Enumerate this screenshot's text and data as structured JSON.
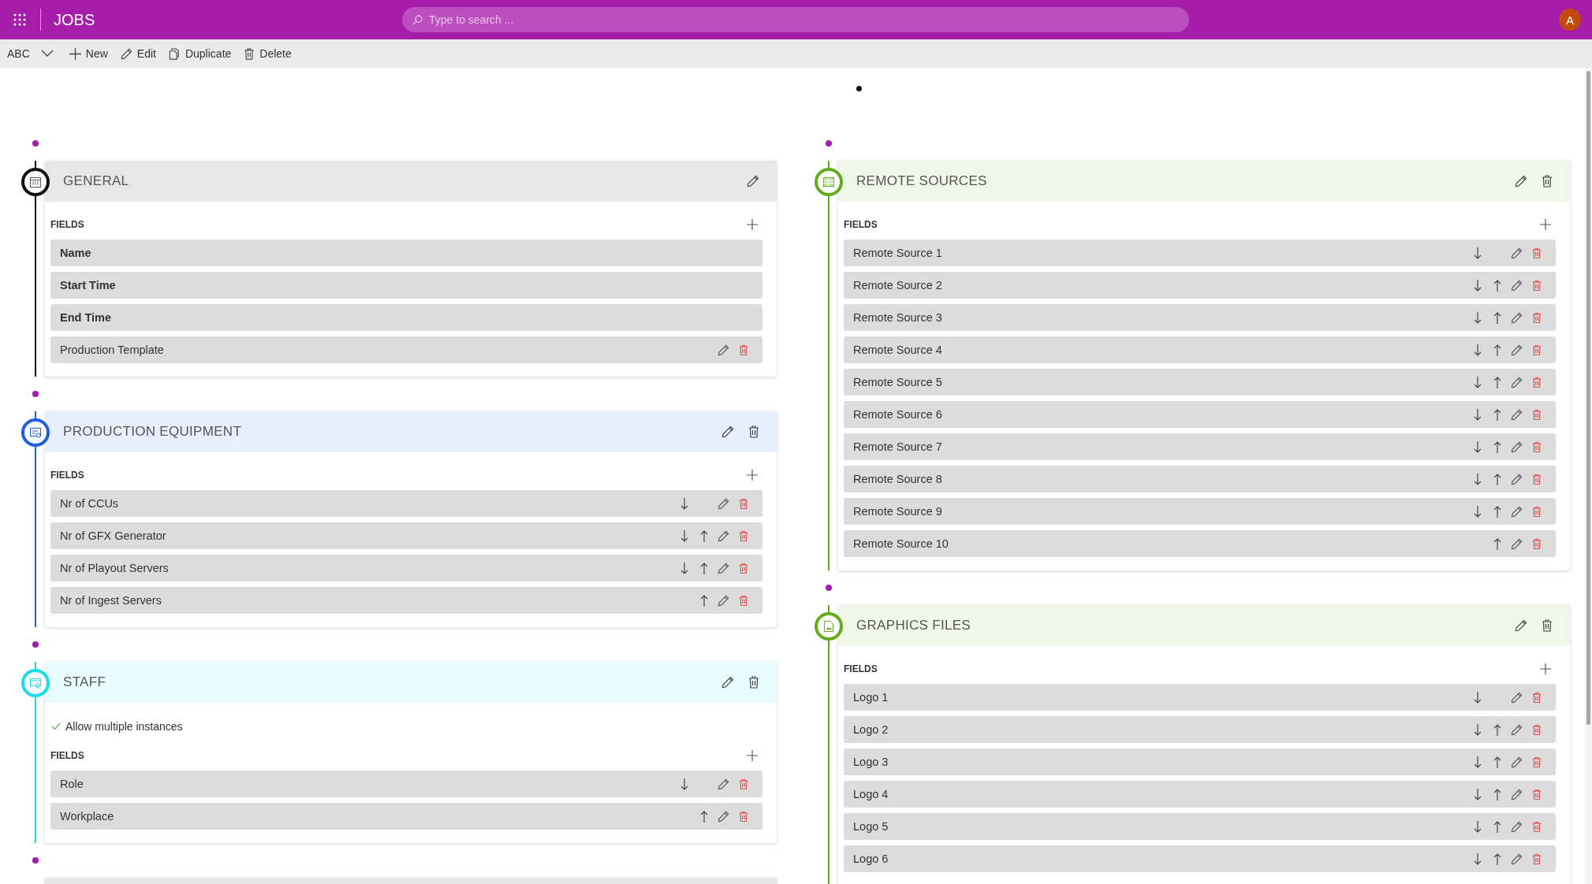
{
  "header": {
    "title": "JOBS",
    "search_placeholder": "Type to search ...",
    "avatar_initial": "A"
  },
  "toolbar": {
    "view": "ABC",
    "buttons": [
      {
        "label": "New"
      },
      {
        "label": "Edit"
      },
      {
        "label": "Duplicate"
      },
      {
        "label": "Delete"
      }
    ]
  },
  "columns": [
    {
      "sections": [
        {
          "title": "GENERAL",
          "color": "#111111",
          "deletable": false,
          "fields_label": "FIELDS",
          "fields": [
            {
              "label": "Name",
              "locked": true
            },
            {
              "label": "Start Time",
              "locked": true
            },
            {
              "label": "End Time",
              "locked": true
            },
            {
              "label": "Production Template",
              "locked": false,
              "move_down": false,
              "move_up": false
            }
          ]
        },
        {
          "title": "PRODUCTION EQUIPMENT",
          "color": "#1d5fe0",
          "deletable": true,
          "fields_label": "FIELDS",
          "fields": [
            {
              "label": "Nr of CCUs",
              "locked": false,
              "move_down": true,
              "move_up": false
            },
            {
              "label": "Nr of GFX Generator",
              "locked": false,
              "move_down": true,
              "move_up": true
            },
            {
              "label": "Nr of Playout Servers",
              "locked": false,
              "move_down": true,
              "move_up": true
            },
            {
              "label": "Nr of Ingest Servers",
              "locked": false,
              "move_down": false,
              "move_up": true
            }
          ]
        },
        {
          "title": "STAFF",
          "color": "#18dde8",
          "deletable": true,
          "options": [
            {
              "label": "Allow multiple instances",
              "checked": true
            }
          ],
          "fields_label": "FIELDS",
          "fields": [
            {
              "label": "Role",
              "locked": false,
              "move_down": true,
              "move_up": false
            },
            {
              "label": "Workplace",
              "locked": false,
              "move_down": false,
              "move_up": true
            }
          ]
        }
      ]
    },
    {
      "sections": [
        {
          "title": "REMOTE SOURCES",
          "color": "#63ad1c",
          "deletable": true,
          "fields_label": "FIELDS",
          "fields": [
            {
              "label": "Remote Source 1",
              "locked": false,
              "move_down": true,
              "move_up": false
            },
            {
              "label": "Remote Source 2",
              "locked": false,
              "move_down": true,
              "move_up": true
            },
            {
              "label": "Remote Source 3",
              "locked": false,
              "move_down": true,
              "move_up": true
            },
            {
              "label": "Remote Source 4",
              "locked": false,
              "move_down": true,
              "move_up": true
            },
            {
              "label": "Remote Source 5",
              "locked": false,
              "move_down": true,
              "move_up": true
            },
            {
              "label": "Remote Source 6",
              "locked": false,
              "move_down": true,
              "move_up": true
            },
            {
              "label": "Remote Source 7",
              "locked": false,
              "move_down": true,
              "move_up": true
            },
            {
              "label": "Remote Source 8",
              "locked": false,
              "move_down": true,
              "move_up": true
            },
            {
              "label": "Remote Source 9",
              "locked": false,
              "move_down": true,
              "move_up": true
            },
            {
              "label": "Remote Source 10",
              "locked": false,
              "move_down": false,
              "move_up": true
            }
          ]
        },
        {
          "title": "GRAPHICS FILES",
          "color": "#63ad1c",
          "deletable": true,
          "fields_label": "FIELDS",
          "fields": [
            {
              "label": "Logo 1",
              "locked": false,
              "move_down": true,
              "move_up": false
            },
            {
              "label": "Logo 2",
              "locked": false,
              "move_down": true,
              "move_up": true
            },
            {
              "label": "Logo 3",
              "locked": false,
              "move_down": true,
              "move_up": true
            },
            {
              "label": "Logo 4",
              "locked": false,
              "move_down": true,
              "move_up": true
            },
            {
              "label": "Logo 5",
              "locked": false,
              "move_down": true,
              "move_up": true
            },
            {
              "label": "Logo 6",
              "locked": false,
              "move_down": true,
              "move_up": true
            }
          ]
        }
      ]
    }
  ]
}
